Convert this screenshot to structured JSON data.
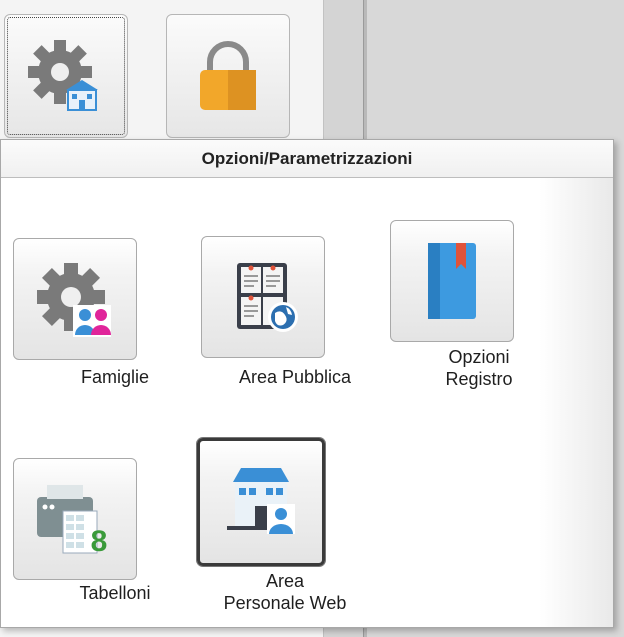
{
  "panel": {
    "title": "Opzioni/Parametrizzazioni",
    "tiles": [
      {
        "label": "Famiglie",
        "icon": "gear-family-icon"
      },
      {
        "label": "Area Pubblica",
        "icon": "bulletin-board-globe-icon"
      },
      {
        "label_line1": "Opzioni",
        "label_line2": "Registro",
        "icon": "book-bookmark-icon"
      },
      {
        "label": "Tabelloni",
        "icon": "printer-sheet-icon"
      },
      {
        "label_line1": "Area",
        "label_line2": "Personale Web",
        "icon": "building-person-icon"
      }
    ]
  },
  "background": {
    "buttons": [
      {
        "icon": "gear-school-icon"
      },
      {
        "icon": "padlock-icon"
      }
    ]
  },
  "colors": {
    "gear": "#7a7a7a",
    "accent_blue": "#3a8fd6",
    "lock_orange": "#f2a72a",
    "book_blue": "#3d9ae0",
    "bookmark_red": "#e0533a",
    "green_digit": "#3a9a3a",
    "family_pink": "#e0259a"
  }
}
